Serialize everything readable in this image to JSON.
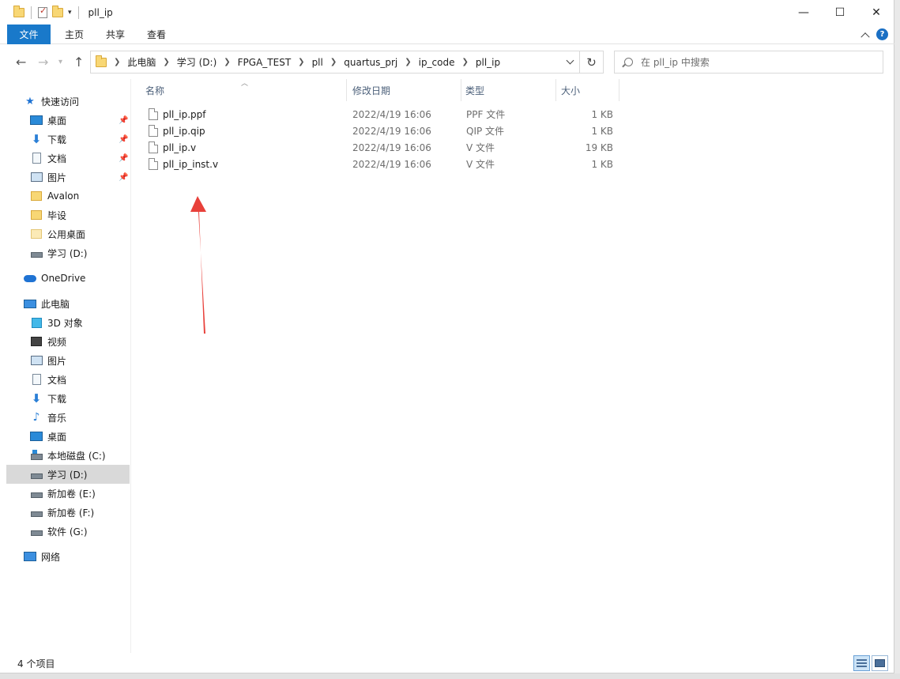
{
  "window": {
    "title": "pll_ip",
    "controls": {
      "minimize": "—",
      "maximize": "☐",
      "close": "✕"
    }
  },
  "ribbon": {
    "tabs": [
      "文件",
      "主页",
      "共享",
      "查看"
    ],
    "help": "?"
  },
  "address": {
    "crumbs": [
      "此电脑",
      "学习 (D:)",
      "FPGA_TEST",
      "pll",
      "quartus_prj",
      "ip_code",
      "pll_ip"
    ],
    "search_placeholder": "在 pll_ip 中搜索"
  },
  "nav": {
    "quick_access": "快速访问",
    "quick_items": [
      {
        "label": "桌面",
        "icon": "desktop-icon",
        "pinned": true
      },
      {
        "label": "下载",
        "icon": "download-icon",
        "pinned": true
      },
      {
        "label": "文档",
        "icon": "document-icon",
        "pinned": true
      },
      {
        "label": "图片",
        "icon": "picture-icon",
        "pinned": true
      },
      {
        "label": "Avalon",
        "icon": "folder-icon",
        "pinned": false
      },
      {
        "label": "毕设",
        "icon": "folder-icon",
        "pinned": false
      },
      {
        "label": "公用桌面",
        "icon": "folder-icon",
        "pinned": false
      },
      {
        "label": "学习 (D:)",
        "icon": "drive-icon",
        "pinned": false
      }
    ],
    "onedrive": "OneDrive",
    "this_pc": "此电脑",
    "pc_items": [
      {
        "label": "3D 对象",
        "icon": "3d-objects-icon"
      },
      {
        "label": "视频",
        "icon": "video-icon"
      },
      {
        "label": "图片",
        "icon": "picture-icon"
      },
      {
        "label": "文档",
        "icon": "document-icon"
      },
      {
        "label": "下载",
        "icon": "download-icon"
      },
      {
        "label": "音乐",
        "icon": "music-icon"
      },
      {
        "label": "桌面",
        "icon": "desktop-icon"
      },
      {
        "label": "本地磁盘 (C:)",
        "icon": "system-drive-icon"
      },
      {
        "label": "学习 (D:)",
        "icon": "drive-icon",
        "selected": true
      },
      {
        "label": "新加卷 (E:)",
        "icon": "drive-icon"
      },
      {
        "label": "新加卷 (F:)",
        "icon": "drive-icon"
      },
      {
        "label": "软件 (G:)",
        "icon": "drive-icon"
      }
    ],
    "network": "网络"
  },
  "columns": {
    "name": "名称",
    "date": "修改日期",
    "type": "类型",
    "size": "大小"
  },
  "files": [
    {
      "name": "pll_ip.ppf",
      "date": "2022/4/19 16:06",
      "type": "PPF 文件",
      "size": "1 KB"
    },
    {
      "name": "pll_ip.qip",
      "date": "2022/4/19 16:06",
      "type": "QIP 文件",
      "size": "1 KB"
    },
    {
      "name": "pll_ip.v",
      "date": "2022/4/19 16:06",
      "type": "V 文件",
      "size": "19 KB"
    },
    {
      "name": "pll_ip_inst.v",
      "date": "2022/4/19 16:06",
      "type": "V 文件",
      "size": "1 KB"
    }
  ],
  "status": {
    "count": "4 个项目"
  },
  "colors": {
    "accent": "#1979ca",
    "annotation_arrow": "#e8403a"
  }
}
